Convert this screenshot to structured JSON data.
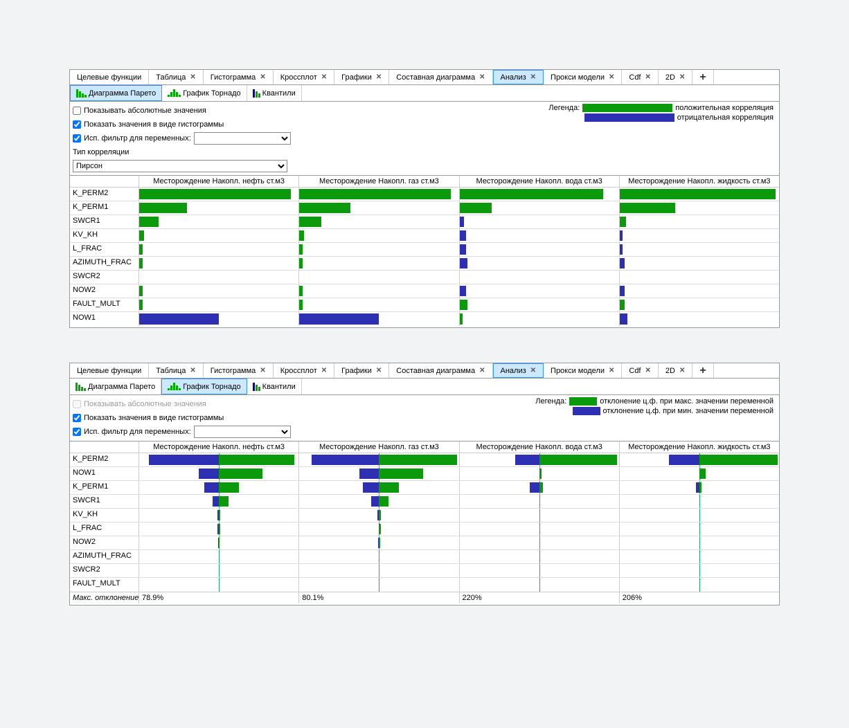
{
  "tabs": [
    {
      "label": "Целевые функции",
      "close": false
    },
    {
      "label": "Таблица",
      "close": true
    },
    {
      "label": "Гистограмма",
      "close": true
    },
    {
      "label": "Кроссплот",
      "close": true
    },
    {
      "label": "Графики",
      "close": true
    },
    {
      "label": "Составная диаграмма",
      "close": true
    },
    {
      "label": "Анализ",
      "close": true,
      "active": true
    },
    {
      "label": "Прокси модели",
      "close": true
    },
    {
      "label": "Cdf",
      "close": true
    },
    {
      "label": "2D",
      "close": true
    }
  ],
  "subtabs": {
    "pareto": "Диаграмма Парето",
    "tornado": "График Торнадо",
    "quantiles": "Квантили"
  },
  "options": {
    "show_abs": "Показывать абсолютные значения",
    "show_hist": "Показать значения в виде гистограммы",
    "var_filter": "Исп. фильтр для переменных:",
    "corr_type_label": "Тип корреляции",
    "corr_type_value": "Пирсон"
  },
  "legend1": {
    "label": "Легенда:",
    "pos": "положительная корреляция",
    "neg": "отрицательная корреляция"
  },
  "legend2": {
    "label": "Легенда:",
    "max": "отклонение ц.ф. при макс. значении переменной",
    "min": "отклонение ц.ф. при мин. значении переменной"
  },
  "columns": [
    "Месторождение Накопл. нефть ст.м3",
    "Месторождение Накопл. газ ст.м3",
    "Месторождение Накопл. вода ст.м3",
    "Месторождение Накопл. жидкость ст.м3"
  ],
  "pareto_rows": [
    {
      "name": "K_PERM2"
    },
    {
      "name": "K_PERM1"
    },
    {
      "name": "SWCR1"
    },
    {
      "name": "KV_KH"
    },
    {
      "name": "L_FRAC"
    },
    {
      "name": "AZIMUTH_FRAC"
    },
    {
      "name": "SWCR2"
    },
    {
      "name": "NOW2"
    },
    {
      "name": "FAULT_MULT"
    },
    {
      "name": "NOW1"
    }
  ],
  "tornado_rows": [
    {
      "name": "K_PERM2"
    },
    {
      "name": "NOW1"
    },
    {
      "name": "K_PERM1"
    },
    {
      "name": "SWCR1"
    },
    {
      "name": "KV_KH"
    },
    {
      "name": "L_FRAC"
    },
    {
      "name": "NOW2"
    },
    {
      "name": "AZIMUTH_FRAC"
    },
    {
      "name": "SWCR2"
    },
    {
      "name": "FAULT_MULT"
    }
  ],
  "footer_label": "Макс. отклонение",
  "footer_vals": [
    "78.9%",
    "80.1%",
    "220%",
    "206%"
  ],
  "chart_data": {
    "pareto": {
      "type": "bar",
      "description": "Pareto correlation bars per variable × objective (fraction of column width, sign = direction)",
      "columns": [
        "Месторождение Накопл. нефть ст.м3",
        "Месторождение Накопл. газ ст.м3",
        "Месторождение Накопл. вода ст.м3",
        "Месторождение Накопл. жидкость ст.м3"
      ],
      "series": [
        {
          "name": "K_PERM2",
          "values": [
            0.95,
            0.95,
            0.9,
            0.98
          ]
        },
        {
          "name": "K_PERM1",
          "values": [
            0.3,
            0.32,
            0.2,
            0.35
          ]
        },
        {
          "name": "SWCR1",
          "values": [
            0.12,
            0.14,
            -0.03,
            0.04
          ]
        },
        {
          "name": "KV_KH",
          "values": [
            0.03,
            0.03,
            -0.04,
            -0.02
          ]
        },
        {
          "name": "L_FRAC",
          "values": [
            0.02,
            0.02,
            -0.04,
            -0.02
          ]
        },
        {
          "name": "AZIMUTH_FRAC",
          "values": [
            0.02,
            0.02,
            -0.05,
            -0.03
          ]
        },
        {
          "name": "SWCR2",
          "values": [
            0.0,
            0.0,
            0.0,
            0.0
          ]
        },
        {
          "name": "NOW2",
          "values": [
            0.02,
            0.02,
            -0.04,
            -0.03
          ]
        },
        {
          "name": "FAULT_MULT",
          "values": [
            0.02,
            0.02,
            0.05,
            0.03
          ]
        },
        {
          "name": "NOW1",
          "values": [
            -0.5,
            -0.5,
            0.02,
            -0.05
          ]
        }
      ]
    },
    "tornado": {
      "type": "bar",
      "description": "Tornado deviations: neg=blue(left), pos=green(right), as fraction of half-width",
      "columns": [
        "Месторождение Накопл. нефть ст.м3",
        "Месторождение Накопл. газ ст.м3",
        "Месторождение Накопл. вода ст.м3",
        "Месторождение Накопл. жидкость ст.м3"
      ],
      "series": [
        {
          "name": "K_PERM2",
          "neg": [
            0.88,
            0.85,
            0.3,
            0.38
          ],
          "pos": [
            0.95,
            0.98,
            0.98,
            0.98
          ]
        },
        {
          "name": "NOW1",
          "neg": [
            0.25,
            0.25,
            0.0,
            0.0
          ],
          "pos": [
            0.55,
            0.55,
            0.03,
            0.08
          ]
        },
        {
          "name": "K_PERM1",
          "neg": [
            0.18,
            0.2,
            0.12,
            0.04
          ],
          "pos": [
            0.25,
            0.25,
            0.05,
            0.03
          ]
        },
        {
          "name": "SWCR1",
          "neg": [
            0.08,
            0.1,
            0.0,
            0.0
          ],
          "pos": [
            0.12,
            0.12,
            0.0,
            0.0
          ]
        },
        {
          "name": "KV_KH",
          "neg": [
            0.02,
            0.02,
            0.0,
            0.0
          ],
          "pos": [
            0.02,
            0.02,
            0.0,
            0.0
          ]
        },
        {
          "name": "L_FRAC",
          "neg": [
            0.02,
            0.0,
            0.0,
            0.0
          ],
          "pos": [
            0.02,
            0.02,
            0.0,
            0.0
          ]
        },
        {
          "name": "NOW2",
          "neg": [
            0.01,
            0.01,
            0.0,
            0.0
          ],
          "pos": [
            0.01,
            0.01,
            0.0,
            0.0
          ]
        },
        {
          "name": "AZIMUTH_FRAC",
          "neg": [
            0.0,
            0.0,
            0.0,
            0.0
          ],
          "pos": [
            0.0,
            0.0,
            0.0,
            0.0
          ]
        },
        {
          "name": "SWCR2",
          "neg": [
            0.0,
            0.0,
            0.0,
            0.0
          ],
          "pos": [
            0.0,
            0.0,
            0.0,
            0.0
          ]
        },
        {
          "name": "FAULT_MULT",
          "neg": [
            0.0,
            0.0,
            0.0,
            0.0
          ],
          "pos": [
            0.0,
            0.0,
            0.0,
            0.0
          ]
        }
      ],
      "max_deviation": [
        "78.9%",
        "80.1%",
        "220%",
        "206%"
      ]
    }
  }
}
